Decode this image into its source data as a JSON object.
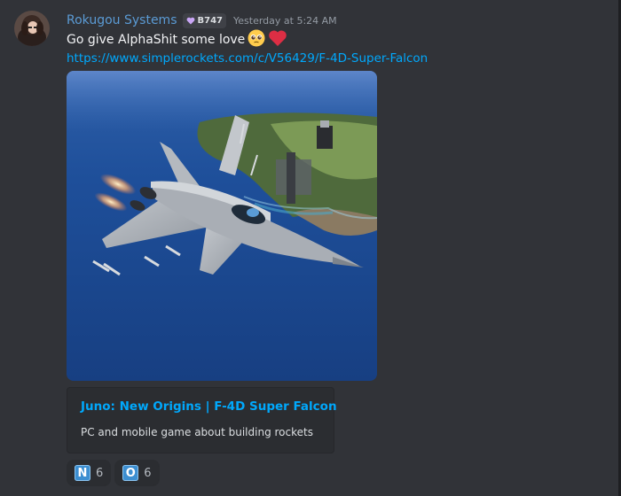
{
  "message": {
    "username": "Rokugou Systems",
    "tag": "B747",
    "timestamp": "Yesterday at 5:24 AM",
    "text": "Go give AlphaShit some love",
    "emojis": [
      "pleading-face",
      "red-heart"
    ],
    "link": "https://www.simplerockets.com/c/V56429/F-4D-Super-Falcon"
  },
  "embed": {
    "title": "Juno: New Origins  | F-4D Super Falcon",
    "description": "PC and mobile game about building rockets"
  },
  "reactions": [
    {
      "emoji": "N",
      "count": "6"
    },
    {
      "emoji": "O",
      "count": "6"
    }
  ],
  "colors": {
    "background": "#313338",
    "username": "#5b9bd5",
    "link": "#00a8fc",
    "embed_bg": "#2b2d31"
  }
}
